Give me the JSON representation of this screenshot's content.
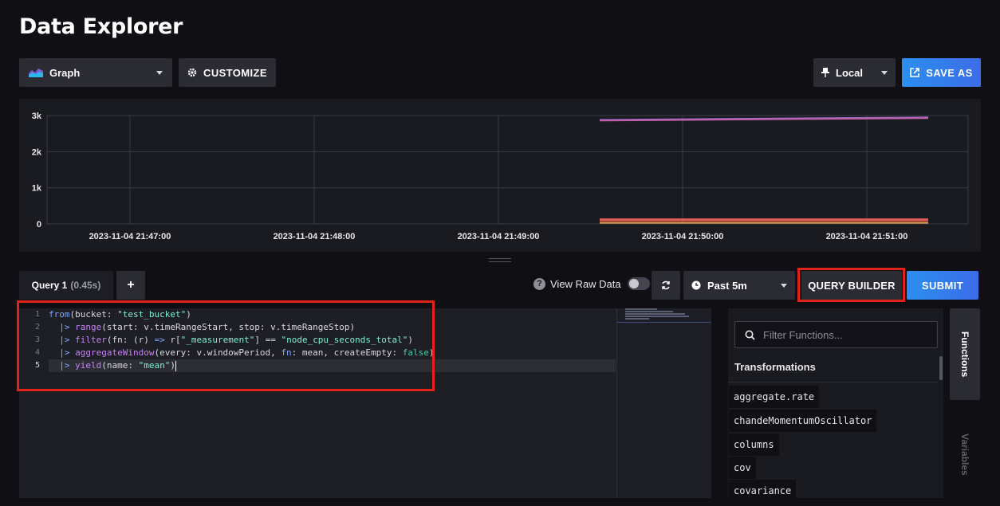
{
  "header": {
    "title": "Data Explorer"
  },
  "toolbar": {
    "graph_type": "Graph",
    "customize": "CUSTOMIZE",
    "timezone": "Local",
    "save_as": "SAVE AS"
  },
  "chart_data": {
    "type": "line",
    "title": "",
    "xlabel": "",
    "ylabel": "",
    "ylim": [
      0,
      3000
    ],
    "y_ticks": [
      "0",
      "1k",
      "2k",
      "3k"
    ],
    "x_ticks": [
      "2023-11-04 21:47:00",
      "2023-11-04 21:48:00",
      "2023-11-04 21:49:00",
      "2023-11-04 21:50:00",
      "2023-11-04 21:51:00"
    ],
    "grid": true,
    "series": [
      {
        "x": [
          "21:49:33",
          "21:51:20"
        ],
        "values": [
          2880,
          2950
        ],
        "color": "#9b6fd6"
      },
      {
        "x": [
          "21:49:33",
          "21:51:20"
        ],
        "values": [
          2860,
          2930
        ],
        "color": "#c05fa6"
      },
      {
        "x": [
          "21:49:33",
          "21:51:20"
        ],
        "values": [
          130,
          130
        ],
        "color": "#e0605c"
      },
      {
        "x": [
          "21:49:33",
          "21:51:20"
        ],
        "values": [
          90,
          90
        ],
        "color": "#d9564e"
      },
      {
        "x": [
          "21:49:33",
          "21:51:20"
        ],
        "values": [
          30,
          30
        ],
        "color": "#e8a04a"
      }
    ]
  },
  "query": {
    "tab_label": "Query 1",
    "tab_time": "(0.45s)",
    "add_tab": "+",
    "view_raw": "View Raw Data",
    "help": "?",
    "time_range": "Past 5m",
    "query_builder": "QUERY BUILDER",
    "submit": "SUBMIT"
  },
  "editor": {
    "line_numbers": [
      "1",
      "2",
      "3",
      "4",
      "5"
    ],
    "lines": {
      "l1": {
        "kw": "from",
        "a": "(bucket: ",
        "s": "\"test_bucket\"",
        "b": ")"
      },
      "l2": {
        "pipe": "  |> ",
        "fn": "range",
        "a": "(start: v.timeRangeStart, stop: v.timeRangeStop)"
      },
      "l3": {
        "pipe": "  |> ",
        "fn": "filter",
        "a": "(fn: (r) ",
        "op": "=>",
        "b": " r[",
        "s1": "\"_measurement\"",
        "c": "] == ",
        "s2": "\"node_cpu_seconds_total\"",
        "d": ")"
      },
      "l4": {
        "pipe": "  |> ",
        "fn": "aggregateWindow",
        "a": "(every: v.windowPeriod, ",
        "k": "fn",
        "b": ": mean, createEmpty: ",
        "f": "false",
        "c": ")"
      },
      "l5": {
        "pipe": "  |> ",
        "fn": "yield",
        "a": "(name: ",
        "s": "\"mean\"",
        "b": ")"
      }
    }
  },
  "functions": {
    "search_placeholder": "Filter Functions...",
    "section": "Transformations",
    "items": [
      "aggregate.rate",
      "chandeMomentumOscillator",
      "columns",
      "cov",
      "covariance"
    ]
  },
  "sidetabs": {
    "functions": "Functions",
    "variables": "Variables"
  }
}
